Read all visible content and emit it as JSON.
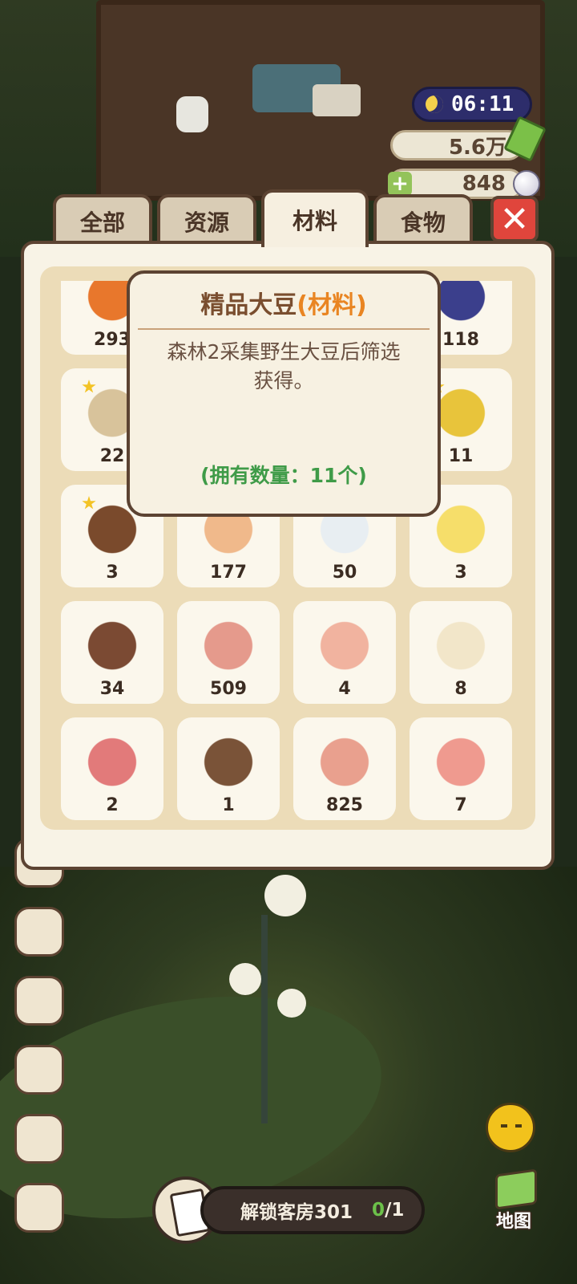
{
  "hud": {
    "time": "06:11",
    "cash": "5.6万",
    "gems": "848",
    "colors": {
      "night_pill": "#2d2d6b",
      "moon": "#f3d04c"
    }
  },
  "tabs": [
    {
      "label": "全部",
      "active": false
    },
    {
      "label": "资源",
      "active": false
    },
    {
      "label": "材料",
      "active": true
    },
    {
      "label": "食物",
      "active": false
    }
  ],
  "close_icon": "close-x-icon",
  "inventory": {
    "items": [
      {
        "icon": "carrot-icon",
        "count": "293"
      },
      {
        "icon": "hidden",
        "count": ""
      },
      {
        "icon": "hidden",
        "count": ""
      },
      {
        "icon": "blueberry-icon",
        "count": "118"
      },
      {
        "icon": "grain-sack-icon",
        "count": "22",
        "premium": true
      },
      {
        "icon": "hidden",
        "count": ""
      },
      {
        "icon": "hidden",
        "count": ""
      },
      {
        "icon": "soybean-bowl-icon",
        "count": "11",
        "premium": true
      },
      {
        "icon": "coconut-icon",
        "count": "3",
        "premium": true
      },
      {
        "icon": "egg-icon",
        "count": "177"
      },
      {
        "icon": "milk-bottle-icon",
        "count": "50"
      },
      {
        "icon": "butter-icon",
        "count": "3"
      },
      {
        "icon": "chocolate-bar-icon",
        "count": "34"
      },
      {
        "icon": "ham-steak-icon",
        "count": "509"
      },
      {
        "icon": "chicken-breast-icon",
        "count": "4"
      },
      {
        "icon": "ginseng-root-icon",
        "count": "8"
      },
      {
        "icon": "pork-belly-icon",
        "count": "2"
      },
      {
        "icon": "dried-meat-icon",
        "count": "1"
      },
      {
        "icon": "leg-bone-icon",
        "count": "825"
      },
      {
        "icon": "bacon-block-icon",
        "count": "7"
      }
    ]
  },
  "tooltip": {
    "name": "精品大豆",
    "category": "(材料)",
    "description_line1": "森林2采集野生大豆后筛选",
    "description_line2": "获得。",
    "quantity": "(拥有数量：11个)",
    "colors": {
      "name": "#7a4e2f",
      "category": "#e98522",
      "quantity": "#3f9b48"
    }
  },
  "quest": {
    "label": "解锁客房301",
    "progress_done": "0",
    "progress_total": "/1"
  },
  "map_button": {
    "label": "地图"
  }
}
